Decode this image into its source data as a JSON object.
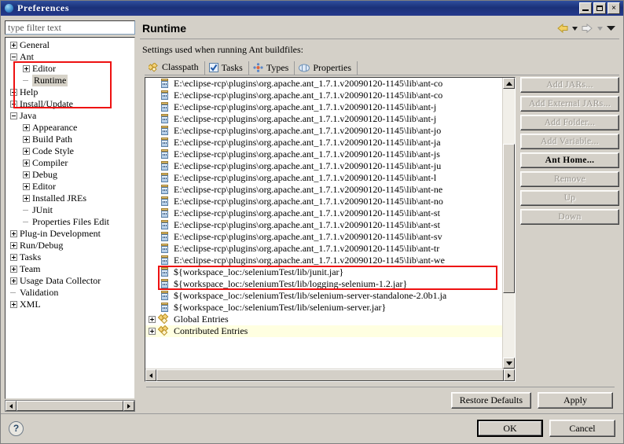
{
  "window": {
    "title": "Preferences",
    "icon": "eclipse-globe-icon",
    "minimize_label": "_",
    "maximize_label": "□",
    "close_label": "×"
  },
  "sidebar": {
    "filter": {
      "placeholder": "type filter text",
      "value": ""
    },
    "tree": [
      {
        "label": "General",
        "indent": 0,
        "state": "collapsed"
      },
      {
        "label": "Ant",
        "indent": 0,
        "state": "expanded"
      },
      {
        "label": "Editor",
        "indent": 1,
        "state": "collapsed"
      },
      {
        "label": "Runtime",
        "indent": 1,
        "state": "leaf",
        "selected": true
      },
      {
        "label": "Help",
        "indent": 0,
        "state": "collapsed"
      },
      {
        "label": "Install/Update",
        "indent": 0,
        "state": "collapsed"
      },
      {
        "label": "Java",
        "indent": 0,
        "state": "expanded"
      },
      {
        "label": "Appearance",
        "indent": 1,
        "state": "collapsed"
      },
      {
        "label": "Build Path",
        "indent": 1,
        "state": "collapsed"
      },
      {
        "label": "Code Style",
        "indent": 1,
        "state": "collapsed"
      },
      {
        "label": "Compiler",
        "indent": 1,
        "state": "collapsed"
      },
      {
        "label": "Debug",
        "indent": 1,
        "state": "collapsed"
      },
      {
        "label": "Editor",
        "indent": 1,
        "state": "collapsed"
      },
      {
        "label": "Installed JREs",
        "indent": 1,
        "state": "collapsed"
      },
      {
        "label": "JUnit",
        "indent": 1,
        "state": "leaf"
      },
      {
        "label": "Properties Files Edit",
        "indent": 1,
        "state": "leaf"
      },
      {
        "label": "Plug-in Development",
        "indent": 0,
        "state": "collapsed"
      },
      {
        "label": "Run/Debug",
        "indent": 0,
        "state": "collapsed"
      },
      {
        "label": "Tasks",
        "indent": 0,
        "state": "collapsed"
      },
      {
        "label": "Team",
        "indent": 0,
        "state": "collapsed"
      },
      {
        "label": "Usage Data Collector",
        "indent": 0,
        "state": "collapsed"
      },
      {
        "label": "Validation",
        "indent": 0,
        "state": "leaf"
      },
      {
        "label": "XML",
        "indent": 0,
        "state": "collapsed"
      }
    ]
  },
  "page": {
    "title": "Runtime",
    "description": "Settings used when running Ant buildfiles:",
    "nav": {
      "back_icon": "back-arrow-icon",
      "back_menu_icon": "chevron-down-icon",
      "forward_icon": "forward-arrow-icon",
      "forward_menu_icon": "chevron-down-icon",
      "view_menu_icon": "view-menu-icon"
    }
  },
  "tabs": [
    {
      "label": "Classpath",
      "icon": "classpath-icon",
      "active": true
    },
    {
      "label": "Tasks",
      "icon": "tasks-icon",
      "active": false
    },
    {
      "label": "Types",
      "icon": "types-icon",
      "active": false
    },
    {
      "label": "Properties",
      "icon": "properties-icon",
      "active": false
    }
  ],
  "classpath_list": [
    {
      "text": "E:\\eclipse-rcp\\plugins\\org.apache.ant_1.7.1.v20090120-1145\\lib\\ant-co",
      "icon": "jar-icon",
      "type": "jar"
    },
    {
      "text": "E:\\eclipse-rcp\\plugins\\org.apache.ant_1.7.1.v20090120-1145\\lib\\ant-co",
      "icon": "jar-icon",
      "type": "jar"
    },
    {
      "text": "E:\\eclipse-rcp\\plugins\\org.apache.ant_1.7.1.v20090120-1145\\lib\\ant-j",
      "icon": "jar-icon",
      "type": "jar"
    },
    {
      "text": "E:\\eclipse-rcp\\plugins\\org.apache.ant_1.7.1.v20090120-1145\\lib\\ant-j",
      "icon": "jar-icon",
      "type": "jar"
    },
    {
      "text": "E:\\eclipse-rcp\\plugins\\org.apache.ant_1.7.1.v20090120-1145\\lib\\ant-jo",
      "icon": "jar-icon",
      "type": "jar"
    },
    {
      "text": "E:\\eclipse-rcp\\plugins\\org.apache.ant_1.7.1.v20090120-1145\\lib\\ant-ja",
      "icon": "jar-icon",
      "type": "jar"
    },
    {
      "text": "E:\\eclipse-rcp\\plugins\\org.apache.ant_1.7.1.v20090120-1145\\lib\\ant-js",
      "icon": "jar-icon",
      "type": "jar"
    },
    {
      "text": "E:\\eclipse-rcp\\plugins\\org.apache.ant_1.7.1.v20090120-1145\\lib\\ant-ju",
      "icon": "jar-icon",
      "type": "jar"
    },
    {
      "text": "E:\\eclipse-rcp\\plugins\\org.apache.ant_1.7.1.v20090120-1145\\lib\\ant-l",
      "icon": "jar-icon",
      "type": "jar"
    },
    {
      "text": "E:\\eclipse-rcp\\plugins\\org.apache.ant_1.7.1.v20090120-1145\\lib\\ant-ne",
      "icon": "jar-icon",
      "type": "jar"
    },
    {
      "text": "E:\\eclipse-rcp\\plugins\\org.apache.ant_1.7.1.v20090120-1145\\lib\\ant-no",
      "icon": "jar-icon",
      "type": "jar"
    },
    {
      "text": "E:\\eclipse-rcp\\plugins\\org.apache.ant_1.7.1.v20090120-1145\\lib\\ant-st",
      "icon": "jar-icon",
      "type": "jar"
    },
    {
      "text": "E:\\eclipse-rcp\\plugins\\org.apache.ant_1.7.1.v20090120-1145\\lib\\ant-st",
      "icon": "jar-icon",
      "type": "jar"
    },
    {
      "text": "E:\\eclipse-rcp\\plugins\\org.apache.ant_1.7.1.v20090120-1145\\lib\\ant-sv",
      "icon": "jar-icon",
      "type": "jar"
    },
    {
      "text": "E:\\eclipse-rcp\\plugins\\org.apache.ant_1.7.1.v20090120-1145\\lib\\ant-tr",
      "icon": "jar-icon",
      "type": "jar"
    },
    {
      "text": "E:\\eclipse-rcp\\plugins\\org.apache.ant_1.7.1.v20090120-1145\\lib\\ant-we",
      "icon": "jar-icon",
      "type": "jar"
    },
    {
      "text": "${workspace_loc:/seleniumTest/lib/junit.jar}",
      "icon": "jar-icon",
      "type": "jar"
    },
    {
      "text": "${workspace_loc:/seleniumTest/lib/logging-selenium-1.2.jar}",
      "icon": "jar-icon",
      "type": "jar"
    },
    {
      "text": "${workspace_loc:/seleniumTest/lib/selenium-server-standalone-2.0b1.ja",
      "icon": "jar-icon",
      "type": "jar"
    },
    {
      "text": "${workspace_loc:/seleniumTest/lib/selenium-server.jar}",
      "icon": "jar-icon",
      "type": "jar"
    }
  ],
  "classpath_groups": [
    {
      "label": "Global Entries",
      "icon": "entries-icon",
      "state": "collapsed",
      "highlighted": false
    },
    {
      "label": "Contributed Entries",
      "icon": "entries-icon",
      "state": "collapsed",
      "highlighted": true
    }
  ],
  "side_buttons": [
    {
      "label": "Add JARs...",
      "enabled": false
    },
    {
      "label": "Add External JARs...",
      "enabled": false
    },
    {
      "label": "Add Folder...",
      "enabled": false
    },
    {
      "label": "Add Variable...",
      "enabled": false
    },
    {
      "label": "Ant Home...",
      "enabled": true
    },
    {
      "label": "Remove",
      "enabled": false
    },
    {
      "label": "Up",
      "enabled": false
    },
    {
      "label": "Down",
      "enabled": false
    }
  ],
  "footer": {
    "restore_defaults": "Restore Defaults",
    "apply": "Apply",
    "ok": "OK",
    "cancel": "Cancel",
    "help_icon": "help-question-icon"
  },
  "annotations": [
    {
      "name": "sidebar-ant-runtime-highlight",
      "color": "#ee1111"
    },
    {
      "name": "junit-jar-entry-highlight",
      "color": "#ee1111"
    }
  ],
  "colors": {
    "titlebar": "#23398c",
    "chrome": "#d4d0c8",
    "highlight_row": "#ffffe1",
    "annotation_red": "#ee1111",
    "selection_gray": "#d6d2c8"
  }
}
